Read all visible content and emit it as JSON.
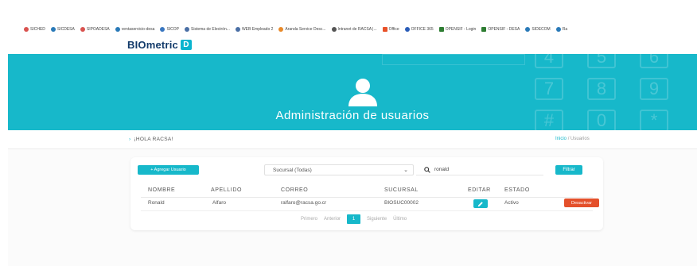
{
  "bookmarks": [
    {
      "label": "SICHED",
      "color": "#d9534f"
    },
    {
      "label": "SICDESA",
      "color": "#2a7ab8"
    },
    {
      "label": "SIPOADESA",
      "color": "#d9534f"
    },
    {
      "label": "ventaservicio-desa",
      "color": "#2a7ab8"
    },
    {
      "label": "SICOP",
      "color": "#3a77c0"
    },
    {
      "label": "Sistema de Electrón...",
      "color": "#4a6fa5"
    },
    {
      "label": "WEB Empleado 2",
      "color": "#4a6fa5"
    },
    {
      "label": "Aranda Service Desc...",
      "color": "#e88a2a"
    },
    {
      "label": "Intranet de RACSA |...",
      "color": "#555555"
    },
    {
      "label": "Office",
      "color": "#e8522a"
    },
    {
      "label": "OFFICE 365",
      "color": "#2a5db8"
    },
    {
      "label": "OPENSIF - Login",
      "color": "#2e7d32"
    },
    {
      "label": "OPENSIF - DESA",
      "color": "#2e7d32"
    },
    {
      "label": "SIDECOM",
      "color": "#2a7ab8"
    },
    {
      "label": "Ra",
      "color": "#2a7ab8"
    }
  ],
  "brand": {
    "name": "BIOmetric",
    "badge": "D"
  },
  "hero": {
    "title": "Administración de usuarios",
    "keys": [
      "4",
      "5",
      "6",
      "7",
      "8",
      "9",
      "#",
      "0",
      "*"
    ]
  },
  "greeting": "¡HOLA RACSA!",
  "breadcrumb": {
    "home": "Inicio",
    "separator": "/",
    "current": "Usuarios"
  },
  "toolbar": {
    "add_label": "+ Agregar Usuario",
    "branch_select": "Sucursal (Todas)",
    "search_value": "ronald",
    "filter_label": "Filtrar"
  },
  "table": {
    "headers": [
      "NOMBRE",
      "APELLIDO",
      "CORREO",
      "SUCURSAL",
      "EDITAR",
      "ESTADO"
    ],
    "rows": [
      {
        "nombre": "Ronald",
        "apellido": "Alfaro",
        "correo": "ralfaro@racsa.go.cr",
        "sucursal": "BIOSUC00002",
        "estado": "Activo",
        "action": "Desactivar"
      }
    ]
  },
  "pagination": {
    "first": "Primero",
    "prev": "Anterior",
    "current": "1",
    "next": "Siguiente",
    "last": "Último"
  },
  "colors": {
    "accent": "#17b8ca",
    "danger": "#e4502b",
    "brand": "#123a6a"
  }
}
